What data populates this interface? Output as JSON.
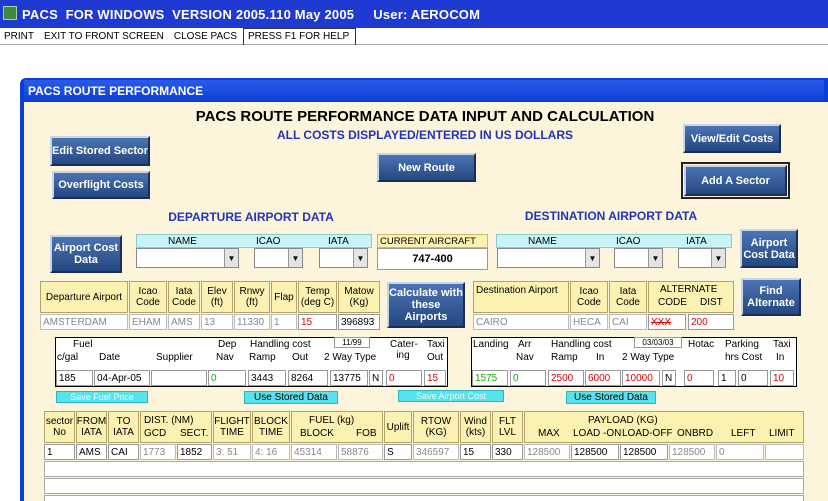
{
  "titlebar": {
    "title": "PACS  FOR WINDOWS  VERSION 2005.110 May 2005     User: AEROCOM"
  },
  "menu": [
    "PRINT",
    "EXIT TO FRONT SCREEN",
    "CLOSE PACS",
    "PRESS F1 FOR HELP"
  ],
  "window": {
    "title": "PACS ROUTE PERFORMANCE"
  },
  "heading": {
    "main": "PACS ROUTE PERFORMANCE DATA INPUT AND CALCULATION",
    "sub": "ALL COSTS DISPLAYED/ENTERED IN US DOLLARS"
  },
  "buttons": {
    "edit_sector": "Edit Stored Sector",
    "overflight": "Overflight Costs",
    "new_route": "New Route",
    "view_costs": "View/Edit Costs",
    "add_sector": "Add A Sector",
    "airport_cost_left": "Airport Cost Data",
    "airport_cost_right": "Airport Cost Data",
    "calculate": "Calculate with these Airports",
    "find_alternate": "Find Alternate"
  },
  "departure": {
    "section_title": "DEPARTURE AIRPORT DATA",
    "col_name": "NAME",
    "col_icao": "ICAO",
    "col_iata": "IATA",
    "headers": {
      "airport": "Departure Airport",
      "icao": "Icao Code",
      "iata": "Iata Code",
      "elev": "Elev (ft)",
      "rnwy": "Rnwy (ft)",
      "flap": "Flap",
      "temp": "Temp (deg C)",
      "matow": "Matow (Kg)"
    },
    "values": {
      "airport": "AMSTERDAM",
      "icao": "EHAM",
      "iata": "AMS",
      "elev": "13",
      "rnwy": "11330",
      "flap": "1",
      "temp": "15",
      "matow": "396893"
    }
  },
  "aircraft": {
    "label": "CURRENT AIRCRAFT",
    "value": "747-400"
  },
  "destination": {
    "section_title": "DESTINATION AIRPORT DATA",
    "col_name": "NAME",
    "col_icao": "ICAO",
    "col_iata": "IATA",
    "headers": {
      "airport": "Destination Airport",
      "icao": "Icao Code",
      "iata": "Iata Code",
      "alternate": "ALTERNATE",
      "alt_code": "CODE",
      "alt_dist": "DIST"
    },
    "values": {
      "airport": "CAIRO",
      "icao": "HECA",
      "iata": "CAI",
      "alt_code": "XXX",
      "alt_dist": "200"
    }
  },
  "dep_costs": {
    "fuel": "Fuel",
    "cgal": "c/gal",
    "date": "Date",
    "supplier": "Supplier",
    "dep": "Dep",
    "nav": "Nav",
    "handling": "Handling cost",
    "date_tag": "11/99",
    "ramp": "Ramp",
    "out": "Out",
    "two_way": "2 Way Type",
    "catering": "Cater- ing",
    "taxi": "Taxi",
    "taxi_out": "Out",
    "values": {
      "cgal": "185",
      "date": "04-Apr-05",
      "supplier": "",
      "nav": "0",
      "ramp": "3443",
      "out": "8264",
      "two_way": "13775",
      "type": "N",
      "catering": "0",
      "taxi": "15"
    }
  },
  "dest_costs": {
    "landing": "Landing",
    "arr": "Arr",
    "nav": "Nav",
    "handling": "Handling cost",
    "date_tag": "03/03/03",
    "ramp": "Ramp",
    "in": "In",
    "two_way": "2 Way Type",
    "hotac": "Hotac",
    "parking": "Parking",
    "hrs_cost": "hrs Cost",
    "taxi": "Taxi",
    "taxi_in": "In",
    "values": {
      "landing": "1575",
      "nav": "0",
      "ramp": "2500",
      "in": "6000",
      "two_way": "10000",
      "type": "N",
      "hotac": "0",
      "hrs": "1",
      "cost": "0",
      "taxi": "10"
    }
  },
  "small_buttons": {
    "save_fuel": "Save Fuel Price",
    "use_stored_1": "Use Stored Data",
    "save_airport": "Save Airport Cost",
    "use_stored_2": "Use Stored Data"
  },
  "sector_table": {
    "headers": {
      "sector": "sector No",
      "from": "FROM IATA",
      "to": "TO IATA",
      "dist": "DIST. (NM)",
      "gcd": "GCD",
      "sect": "SECT.",
      "flight": "FLIGHT TIME",
      "block": "BLOCK TIME",
      "fuel": "FUEL (kg)",
      "fuel_block": "BLOCK",
      "fob": "FOB",
      "uplift": "Uplift",
      "rtow": "RTOW (KG)",
      "wind": "Wind (kts)",
      "flt": "FLT LVL",
      "payload": "PAYLOAD (KG)",
      "max": "MAX",
      "load_on": "LOAD -ON",
      "load_off": "LOAD-OFF",
      "onbrd": "ONBRD",
      "left": "LEFT",
      "limit": "LIMIT"
    },
    "rows": [
      {
        "sector": "1",
        "from": "AMS",
        "to": "CAI",
        "gcd": "1773",
        "sect": "1852",
        "flight": "3: 51",
        "block": "4: 16",
        "fuel_block": "45314",
        "fob": "58876",
        "uplift": "S",
        "rtow": "346597",
        "wind": "15",
        "flt": "330",
        "max": "128500",
        "load_on": "128500",
        "load_off": "128500",
        "onbrd": "128500",
        "left": "0",
        "limit": ""
      }
    ]
  }
}
